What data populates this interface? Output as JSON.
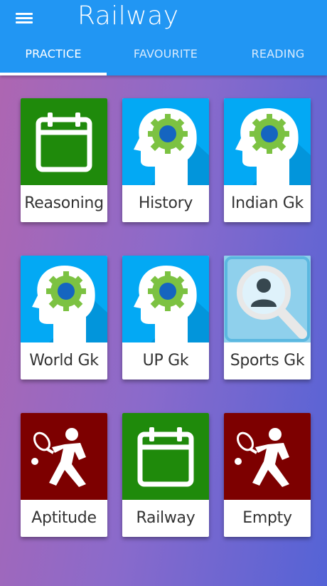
{
  "header": {
    "title": "Railway",
    "menu_icon": "hamburger-menu-icon",
    "background": "#2196f3"
  },
  "tabs": [
    {
      "label": "PRACTICE",
      "active": true
    },
    {
      "label": "FAVOURITE",
      "active": false
    },
    {
      "label": "READING",
      "active": false
    }
  ],
  "categories": [
    {
      "label": "Reasoning",
      "icon": "calendar-icon",
      "color": "#1f8a0b"
    },
    {
      "label": "History",
      "icon": "brain-gear-head-icon",
      "color": "#03a9f4"
    },
    {
      "label": "Indian Gk",
      "icon": "brain-gear-head-icon",
      "color": "#03a9f4"
    },
    {
      "label": "World Gk",
      "icon": "brain-gear-head-icon",
      "color": "#03a9f4"
    },
    {
      "label": "UP Gk",
      "icon": "brain-gear-head-icon",
      "color": "#03a9f4"
    },
    {
      "label": "Sports Gk",
      "icon": "magnifier-person-icon",
      "color": "#8fd0ec"
    },
    {
      "label": "Aptitude",
      "icon": "tennis-player-icon",
      "color": "#7d0000"
    },
    {
      "label": "Railway",
      "icon": "calendar-icon",
      "color": "#1f8a0b"
    },
    {
      "label": "Empty",
      "icon": "tennis-player-icon",
      "color": "#7d0000"
    }
  ]
}
